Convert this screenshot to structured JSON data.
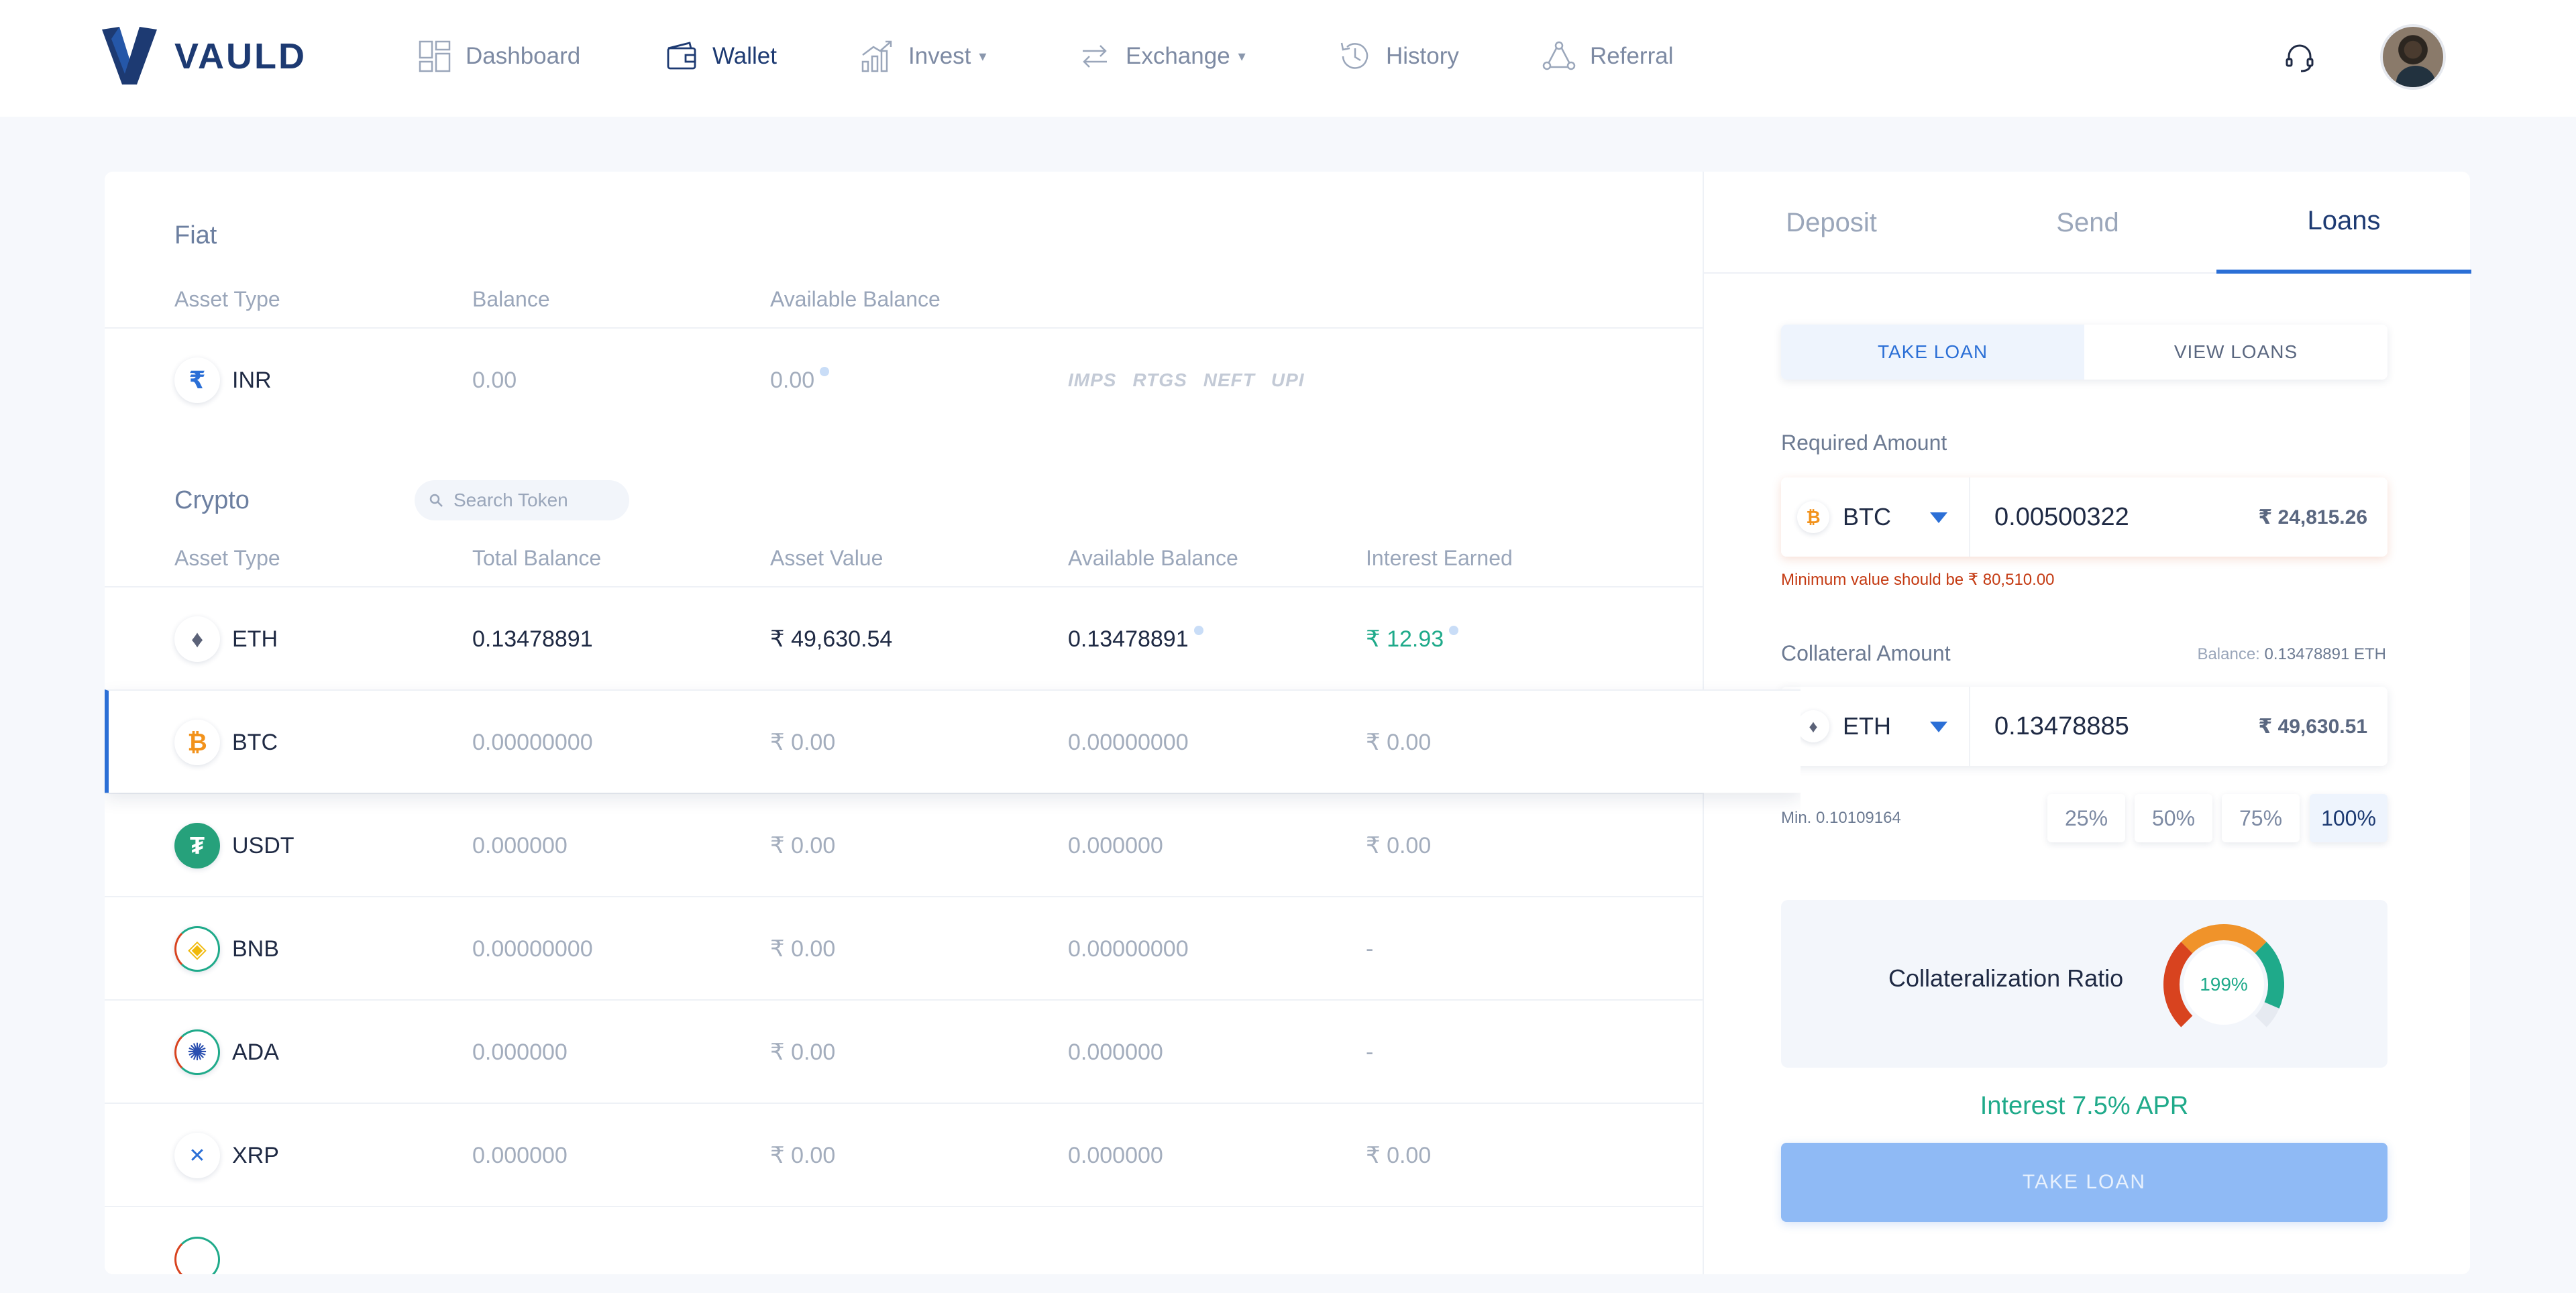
{
  "brand": {
    "name": "VAULD"
  },
  "nav": {
    "items": [
      {
        "label": "Dashboard"
      },
      {
        "label": "Wallet"
      },
      {
        "label": "Invest"
      },
      {
        "label": "Exchange"
      },
      {
        "label": "History"
      },
      {
        "label": "Referral"
      }
    ],
    "caret": "▾"
  },
  "fiat": {
    "title": "Fiat",
    "headers": [
      "Asset Type",
      "Balance",
      "Available Balance"
    ],
    "row": {
      "symbol": "INR",
      "icon": "₹",
      "balance": "0.00",
      "available": "0.00"
    },
    "methods": [
      "IMPS",
      "RTGS",
      "NEFT",
      "UPI"
    ]
  },
  "crypto": {
    "title": "Crypto",
    "search_placeholder": "Search Token",
    "headers": [
      "Asset Type",
      "Total Balance",
      "Asset Value",
      "Available Balance",
      "Interest Earned"
    ],
    "rows": [
      {
        "symbol": "ETH",
        "icon": "♦",
        "total": "0.13478891",
        "value": "₹ 49,630.54",
        "available": "0.13478891",
        "interest": "₹ 12.93"
      },
      {
        "symbol": "BTC",
        "icon": "₿",
        "total": "0.00000000",
        "value": "₹ 0.00",
        "available": "0.00000000",
        "interest": "₹ 0.00"
      },
      {
        "symbol": "USDT",
        "icon": "₮",
        "total": "0.000000",
        "value": "₹ 0.00",
        "available": "0.000000",
        "interest": "₹ 0.00"
      },
      {
        "symbol": "BNB",
        "icon": "◈",
        "total": "0.00000000",
        "value": "₹ 0.00",
        "available": "0.00000000",
        "interest": "-"
      },
      {
        "symbol": "ADA",
        "icon": "✺",
        "total": "0.000000",
        "value": "₹ 0.00",
        "available": "0.000000",
        "interest": "-"
      },
      {
        "symbol": "XRP",
        "icon": "✕",
        "total": "0.000000",
        "value": "₹ 0.00",
        "available": "0.000000",
        "interest": "₹ 0.00"
      }
    ]
  },
  "panel": {
    "tabs": [
      "Deposit",
      "Send",
      "Loans"
    ],
    "toggle": {
      "take": "TAKE LOAN",
      "view": "VIEW LOANS"
    },
    "required": {
      "label": "Required Amount",
      "coin": "BTC",
      "coin_icon": "₿",
      "amount": "0.00500322",
      "fiat": "₹ 24,815.26",
      "error": "Minimum value should be ₹ 80,510.00"
    },
    "collateral": {
      "label": "Collateral Amount",
      "balance_label": "Balance:",
      "balance_value": "0.13478891 ETH",
      "coin": "ETH",
      "coin_icon": "♦",
      "amount": "0.13478885",
      "fiat": "₹ 49,630.51",
      "min": "Min. 0.10109164"
    },
    "percents": [
      "25%",
      "50%",
      "75%",
      "100%"
    ],
    "ratio": {
      "label": "Collateralization Ratio",
      "value_text": "199%",
      "fill": 0.92
    },
    "interest": "Interest 7.5% APR",
    "cta": "TAKE LOAN"
  },
  "colors": {
    "brand": "#1d3a72",
    "accent": "#2b6fd6",
    "positive": "#1faa8a",
    "error": "#c43a12",
    "gauge_red": "#d8431f",
    "gauge_orange": "#f0932a",
    "gauge_green": "#1faa8a"
  }
}
